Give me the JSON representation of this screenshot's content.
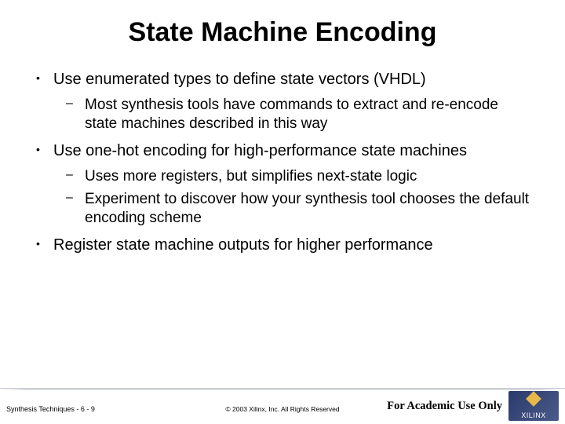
{
  "title": "State Machine Encoding",
  "bullets": [
    {
      "text": "Use enumerated types to define state vectors (VHDL)",
      "sub": [
        "Most synthesis tools have commands to extract and re-encode state machines described in this way"
      ]
    },
    {
      "text": "Use one-hot encoding for high-performance state machines",
      "sub": [
        "Uses more registers, but simplifies next-state logic",
        "Experiment to discover how your synthesis tool chooses the default encoding scheme"
      ]
    },
    {
      "text": "Register state machine outputs for higher performance",
      "sub": []
    }
  ],
  "footer": {
    "left": "Synthesis Techniques  -  6 - 9",
    "center": "© 2003 Xilinx, Inc. All Rights Reserved",
    "academic": "For Academic Use Only",
    "logo_text": "XILINX"
  }
}
